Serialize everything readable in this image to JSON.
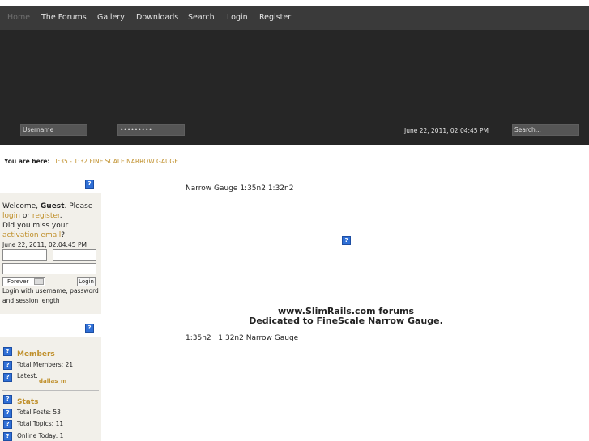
{
  "nav": {
    "items": [
      {
        "label": "Home"
      },
      {
        "label": "The Forums"
      },
      {
        "label": "Gallery"
      },
      {
        "label": "Downloads"
      },
      {
        "label": "Search"
      },
      {
        "label": "Login"
      },
      {
        "label": "Register"
      }
    ]
  },
  "header": {
    "username_value": "Username",
    "password_value": "•••••••••",
    "datetime": "June 22, 2011, 02:04:45 PM",
    "search_value": "Search..."
  },
  "breadcrumb": {
    "label": "You are here:",
    "link": "1:35 - 1:32 FINE SCALE NARROW GAUGE"
  },
  "login_box": {
    "welcome": "Welcome,",
    "guest": "Guest",
    "please": ". Please",
    "login_link": "login",
    "or": "or",
    "register_link": "register",
    "period": ".",
    "miss_text": "Did you miss your",
    "activation_link": "activation email",
    "question": "?",
    "datetime": "June 22, 2011, 02:04:45 PM",
    "duration_value": "Forever",
    "login_button": "Login",
    "hint": "Login with username, password and session length"
  },
  "stats_box": {
    "members_title": "Members",
    "total_members": "Total Members: 21",
    "latest_label": "Latest:",
    "latest_user": "dallas_m",
    "stats_title": "Stats",
    "total_posts": "Total Posts: 53",
    "total_topics": "Total Topics: 11",
    "online_today": "Online Today: 1"
  },
  "main": {
    "top_text": "Narrow Gauge 1:35n2 1:32n2",
    "title_line1": "www.SlimRails.com forums",
    "title_line2": "Dedicated to FineScale Narrow Gauge.",
    "bottom_text": "1:35n2   1:32n2 Narrow Gauge"
  },
  "colors": {
    "nav_bg": "#3a3a3a",
    "header_bg": "#262626",
    "link": "#c0902c",
    "sidebar_bg": "#f2f0ea"
  },
  "icons": {
    "placeholder": "question-image-icon"
  }
}
